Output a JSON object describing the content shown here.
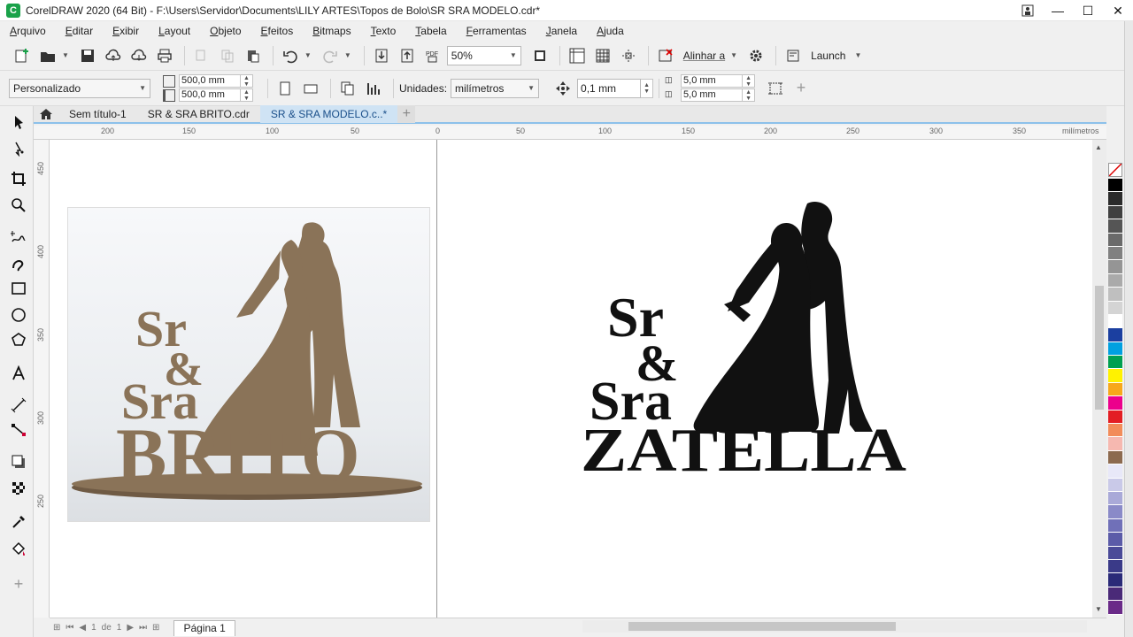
{
  "window": {
    "title": "CorelDRAW 2020 (64 Bit) - F:\\Users\\Servidor\\Documents\\LILY ARTES\\Topos de Bolo\\SR  SRA MODELO.cdr*"
  },
  "menu": [
    "Arquivo",
    "Editar",
    "Exibir",
    "Layout",
    "Objeto",
    "Efeitos",
    "Bitmaps",
    "Texto",
    "Tabela",
    "Ferramentas",
    "Janela",
    "Ajuda"
  ],
  "toolbar": {
    "zoom": "50%",
    "align_label": "Alinhar a",
    "launch_label": "Launch",
    "pdf_label": "PDF"
  },
  "property_bar": {
    "preset": "Personalizado",
    "width": "500,0 mm",
    "height": "500,0 mm",
    "units_label": "Unidades:",
    "units_value": "milímetros",
    "nudge": "0,1 mm",
    "dup_x": "5,0 mm",
    "dup_y": "5,0 mm"
  },
  "tabs": [
    "Sem título-1",
    "SR & SRA BRITO.cdr",
    "SR & SRA MODELO.c..*"
  ],
  "ruler": {
    "top_labels": [
      "200",
      "150",
      "100",
      "50",
      "0",
      "50",
      "100",
      "150",
      "200",
      "250",
      "300",
      "350"
    ],
    "unit": "milímetros",
    "left_labels": [
      "450",
      "400",
      "350",
      "300",
      "250"
    ]
  },
  "artwork": {
    "photo_line1": "Sr",
    "photo_amp": "&",
    "photo_line2": "Sra",
    "photo_name": "BRITO",
    "vector_line1": "Sr",
    "vector_amp": "&",
    "vector_line2": "Sra",
    "vector_name": "ZATELLA"
  },
  "page_nav": {
    "current": "1",
    "of": "de",
    "total": "1",
    "page_tab": "Página 1"
  },
  "colors": {
    "accent": "#1aa24a",
    "tab_active": "#cfe3f4",
    "mdf": "#8a7358",
    "silhouette": "#111111"
  },
  "palette": [
    "#000000",
    "#2b2b2b",
    "#404040",
    "#555555",
    "#6a6a6a",
    "#808080",
    "#959595",
    "#aaaaaa",
    "#bfbfbf",
    "#d4d4d4",
    "#ffffff",
    "#1b3fa0",
    "#00a0e0",
    "#00a050",
    "#fff200",
    "#f7a81b",
    "#ec008c",
    "#e31e24",
    "#f28c5a",
    "#f6b8b0",
    "#8c6a4f",
    "#e8e8f8",
    "#c9c9e8",
    "#a9a9d8",
    "#8a8ac8",
    "#7070b8",
    "#5b5ba8",
    "#4a4a98",
    "#3a3a88",
    "#2a2a78",
    "#4a2a78",
    "#6a2a88"
  ]
}
